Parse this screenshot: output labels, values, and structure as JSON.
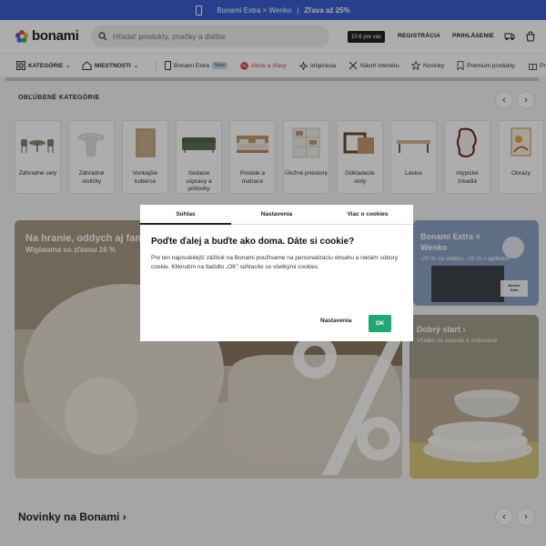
{
  "promo": {
    "left": "Bonami Extra × Wenko",
    "separator": "|",
    "right": "Zľava až 25%"
  },
  "header": {
    "logo": "bonami",
    "search_placeholder": "Hľadať produkty, značky a ďalšie",
    "gift_badge": "10 € pre vás",
    "register": "REGISTRÁCIA",
    "login": "PRIHLÁSENIE"
  },
  "nav": {
    "categories": "KATEGÓRIE",
    "rooms": "MIESTNOSTI",
    "extra": "Bonami Extra",
    "new_badge": "New",
    "sales": "Akcie a zľavy",
    "inspiration": "Inšpirácia",
    "design": "Návrh interiéru",
    "news": "Novinky",
    "premium": "Premium produkty",
    "more": "Pr"
  },
  "popular": {
    "title": "OBĽÚBENÉ KATEGÓRIE",
    "items": [
      {
        "label": "Záhradné sety"
      },
      {
        "label": "Záhradné stoličky"
      },
      {
        "label": "Vonkajšie koberce"
      },
      {
        "label": "Sedacie súpravy a pohovky"
      },
      {
        "label": "Postele a matrace"
      },
      {
        "label": "Úložné priestory"
      },
      {
        "label": "Odkladacie stoly"
      },
      {
        "label": "Lavice"
      },
      {
        "label": "Atypické zrkadlá"
      },
      {
        "label": "Obrazy"
      }
    ]
  },
  "hero": {
    "left_title": "Na hranie, oddych aj fantá",
    "left_sub": "Wigiwama so zľavou 16 %",
    "rt_title": "Bonami Extra × Wenko",
    "rt_sub": "-20 % na všetko, -25 % v aplikácii",
    "rt_brand": "Bonami Extra",
    "rb_title": "Dobrý start ›",
    "rb_sub": "Všetko na varenie a stolovanie"
  },
  "bottom": {
    "title": "Novinky na Bonami ›"
  },
  "cookie": {
    "tabs": [
      "Súhlas",
      "Nastavenia",
      "Viac o cookies"
    ],
    "title": "Poďte ďalej a buďte ako doma. Dáte si cookie?",
    "text": "Pre ten najosobitejší zážitok na Bonami používame na personalizáciu obsahu a reklám súbory cookie. Kliknutím na tlačidlo „OK“ súhlasíte so všetkými cookies.",
    "settings_label": "Nastavenia",
    "ok_label": "OK"
  },
  "colors": {
    "promo": "#3a5fd0",
    "ok": "#1fa874",
    "sale": "#d83a3a"
  }
}
